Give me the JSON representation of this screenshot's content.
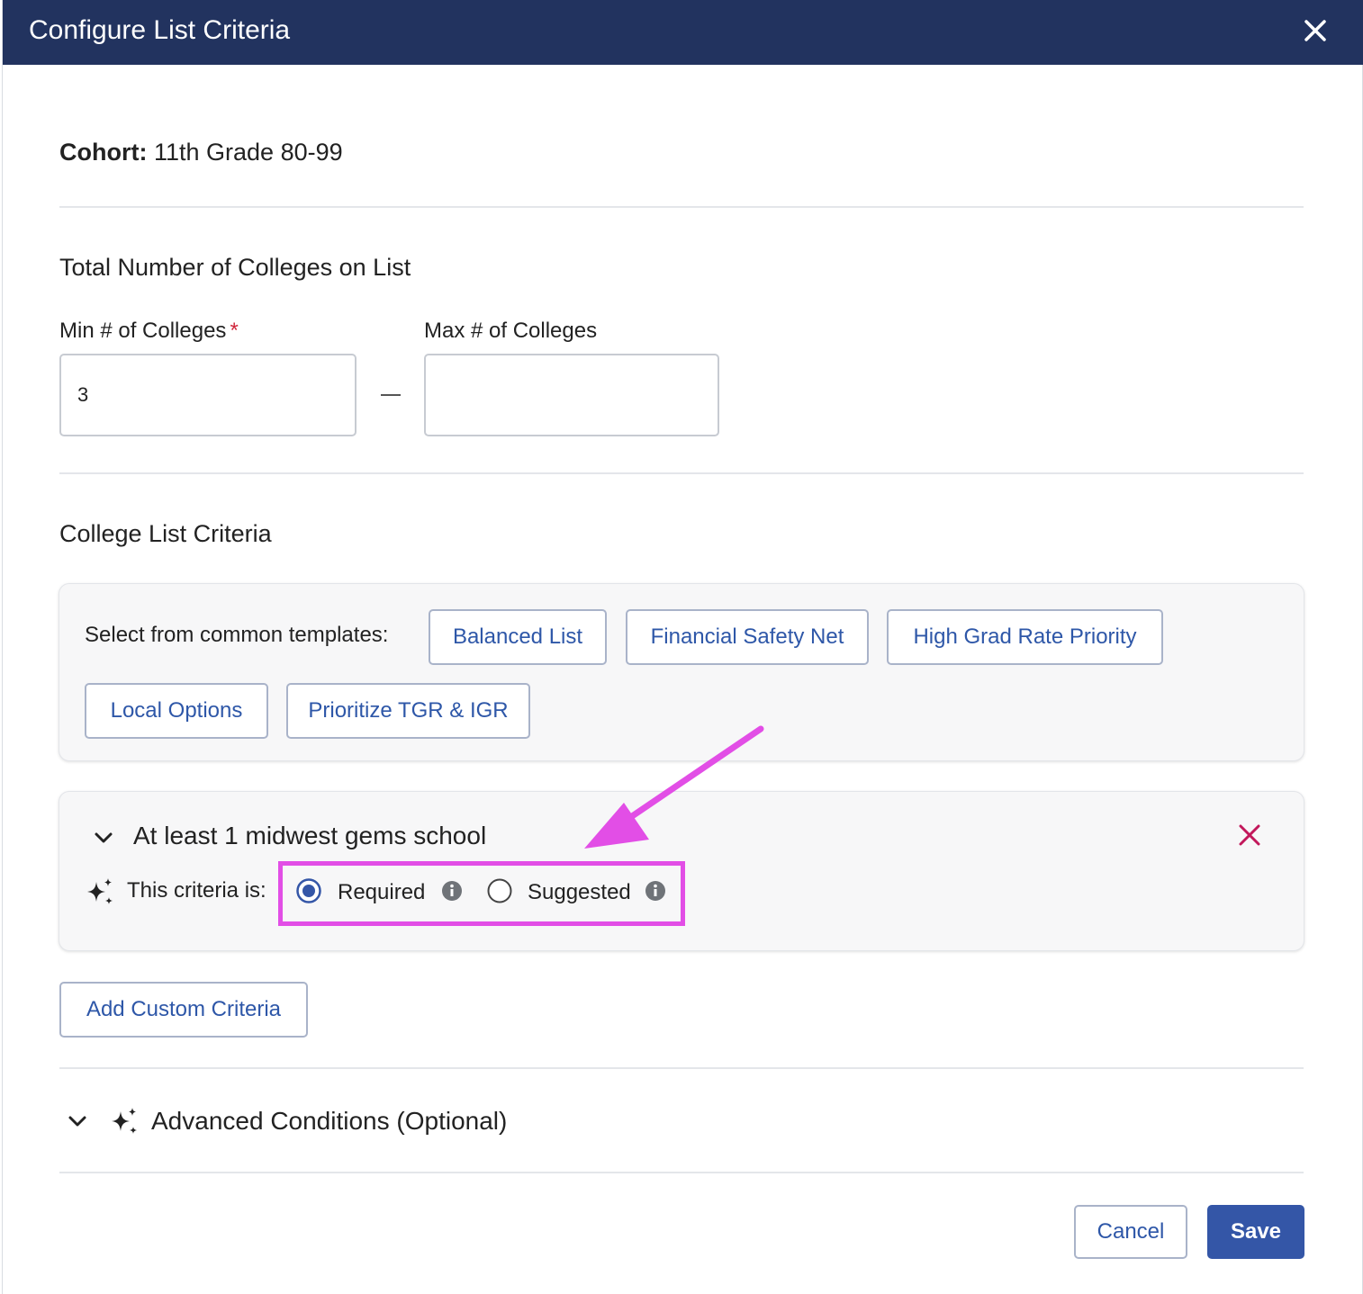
{
  "dialog": {
    "title": "Configure List Criteria",
    "close_icon": "close-icon"
  },
  "cohort": {
    "label": "Cohort:",
    "value": "11th Grade 80-99"
  },
  "total_section": {
    "heading": "Total Number of Colleges on List",
    "min_label": "Min # of Colleges",
    "min_required_mark": "*",
    "min_value": "3",
    "max_label": "Max # of Colleges",
    "max_value": ""
  },
  "criteria_section": {
    "heading": "College List Criteria",
    "templates_label": "Select from common templates:",
    "templates": [
      "Balanced List",
      "Financial Safety Net",
      "High Grad Rate Priority",
      "Local Options",
      "Prioritize TGR & IGR"
    ]
  },
  "criteria_item": {
    "title": "At least 1 midwest gems school",
    "type_label": "This criteria is:",
    "options": [
      "Required",
      "Suggested"
    ],
    "selected": "Required",
    "icons": [
      "chevron-down-icon",
      "sparkle-icon",
      "info-icon",
      "remove-icon"
    ]
  },
  "add_custom_label": "Add Custom Criteria",
  "advanced": {
    "title": "Advanced Conditions (Optional)"
  },
  "footer": {
    "cancel_label": "Cancel",
    "save_label": "Save"
  },
  "colors": {
    "header_bg": "#22335f",
    "accent": "#3456a7",
    "link_text": "#2e57a8",
    "highlight": "#e24ee6",
    "remove_x": "#c2185b",
    "required_star": "#d0263b"
  }
}
